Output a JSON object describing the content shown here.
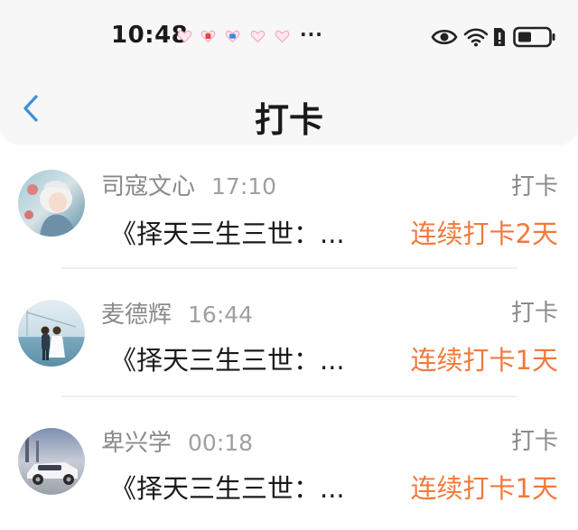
{
  "status_bar": {
    "time": "10:48",
    "more": "···"
  },
  "nav": {
    "title": "打卡"
  },
  "colors": {
    "accent_orange": "#f07a3c",
    "back_blue": "#3b8fe0"
  },
  "items": [
    {
      "name": "司寇文心",
      "time": "17:10",
      "tag": "打卡",
      "message": "《择天三生三世：...",
      "streak": "连续打卡2天"
    },
    {
      "name": "麦德辉",
      "time": "16:44",
      "tag": "打卡",
      "message": "《择天三生三世：...",
      "streak": "连续打卡1天"
    },
    {
      "name": "卑兴学",
      "time": "00:18",
      "tag": "打卡",
      "message": "《择天三生三世：...",
      "streak": "连续打卡1天"
    }
  ]
}
